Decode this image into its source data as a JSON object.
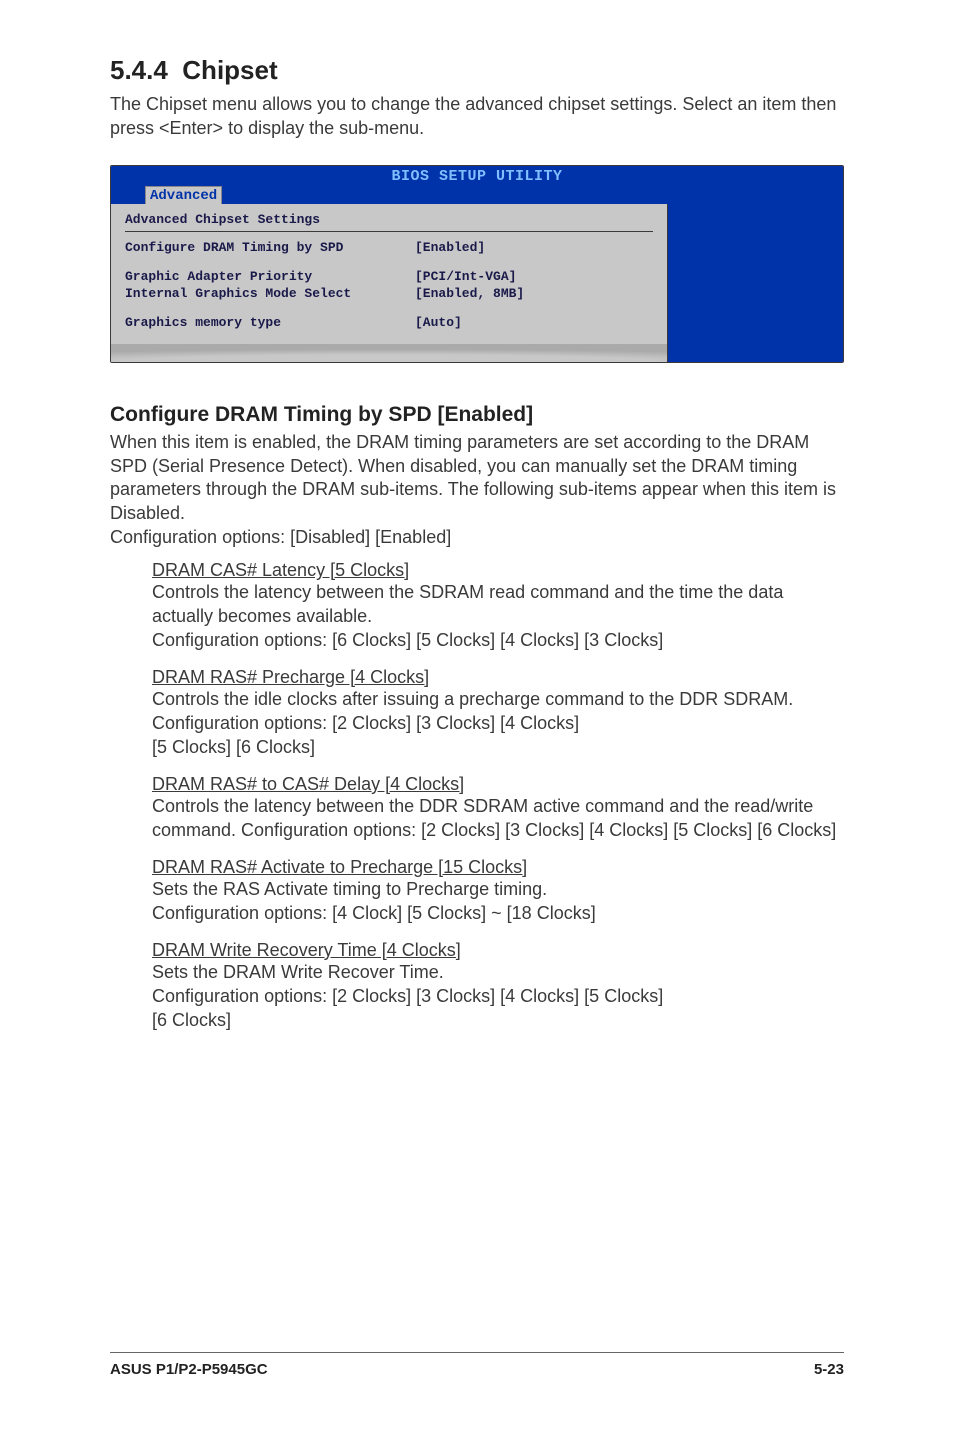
{
  "section": {
    "number": "5.4.4",
    "title": "Chipset"
  },
  "intro": "The Chipset menu allows you to change the advanced chipset settings. Select an item then press <Enter> to display the sub-menu.",
  "bios": {
    "util_title": "BIOS SETUP UTILITY",
    "tab": "Advanced",
    "heading": "Advanced Chipset Settings",
    "rows": [
      {
        "label": "Configure DRAM Timing by SPD",
        "value": "[Enabled]"
      },
      {
        "spacer": true
      },
      {
        "label": "Graphic Adapter Priority",
        "value": "[PCI/Int-VGA]"
      },
      {
        "label": "Internal Graphics Mode Select",
        "value": "[Enabled, 8MB]"
      },
      {
        "spacer": true
      },
      {
        "label": "Graphics memory type",
        "value": "[Auto]"
      }
    ]
  },
  "configure_head": "Configure DRAM Timing by SPD [Enabled]",
  "configure_body": "When this item is enabled, the DRAM timing parameters are set according to the DRAM SPD (Serial Presence Detect). When disabled, you can manually set the DRAM timing parameters through the DRAM sub-items. The following sub-items appear when this item is Disabled.\nConfiguration options: [Disabled] [Enabled]",
  "items": [
    {
      "title": "DRAM CAS# Latency [5 Clocks]",
      "body": "Controls the latency between the SDRAM read command and the time the data actually becomes available.\nConfiguration options: [6 Clocks] [5 Clocks] [4 Clocks] [3 Clocks]"
    },
    {
      "title": "DRAM RAS# Precharge [4 Clocks]",
      "body": "Controls the idle clocks after issuing a precharge command to the DDR SDRAM. Configuration options: [2 Clocks] [3 Clocks] [4 Clocks]\n[5 Clocks] [6 Clocks]"
    },
    {
      "title": "DRAM RAS# to CAS# Delay [4 Clocks]",
      "body": "Controls the latency between the DDR SDRAM active command and the read/write command. Configuration options: [2 Clocks] [3 Clocks] [4 Clocks] [5 Clocks] [6 Clocks]"
    },
    {
      "title": "DRAM RAS# Activate to Precharge [15 Clocks]",
      "body": "Sets the RAS Activate timing to Precharge timing.\nConfiguration options: [4 Clock] [5 Clocks] ~ [18 Clocks]"
    },
    {
      "title": "DRAM Write Recovery Time [4 Clocks]",
      "body": "Sets the DRAM Write Recover Time.\nConfiguration options: [2 Clocks] [3 Clocks] [4 Clocks] [5 Clocks]\n[6 Clocks]"
    }
  ],
  "footer": {
    "left": "ASUS P1/P2-P5945GC",
    "right": "5-23"
  }
}
